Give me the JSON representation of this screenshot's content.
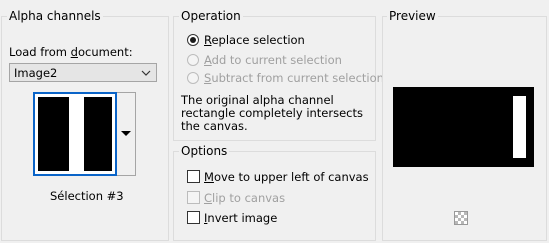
{
  "alpha_channels": {
    "title": "Alpha channels",
    "load_label_prefix": "Load from ",
    "load_label_underlined": "d",
    "load_label_rest": "ocument:",
    "document_select": {
      "value": "Image2"
    },
    "selection_name": "Sélection #3"
  },
  "operation": {
    "title": "Operation",
    "options": [
      {
        "mnemonic": "R",
        "rest": "eplace selection",
        "selected": true,
        "enabled": true
      },
      {
        "mnemonic": "A",
        "rest": "dd to current selection",
        "selected": false,
        "enabled": false
      },
      {
        "mnemonic": "S",
        "rest": "ubtract from current selection",
        "selected": false,
        "enabled": false
      }
    ],
    "note": "The original alpha channel rectangle completely intersects the canvas."
  },
  "options": {
    "title": "Options",
    "items": [
      {
        "mnemonic": "M",
        "rest": "ove to upper left of canvas",
        "checked": false,
        "enabled": true
      },
      {
        "mnemonic": "C",
        "rest": "lip to canvas",
        "checked": false,
        "enabled": false
      },
      {
        "mnemonic": "I",
        "rest": "nvert image",
        "checked": false,
        "enabled": true
      }
    ]
  },
  "preview": {
    "title": "Preview",
    "zoom_icon": "checkerboard-icon"
  }
}
